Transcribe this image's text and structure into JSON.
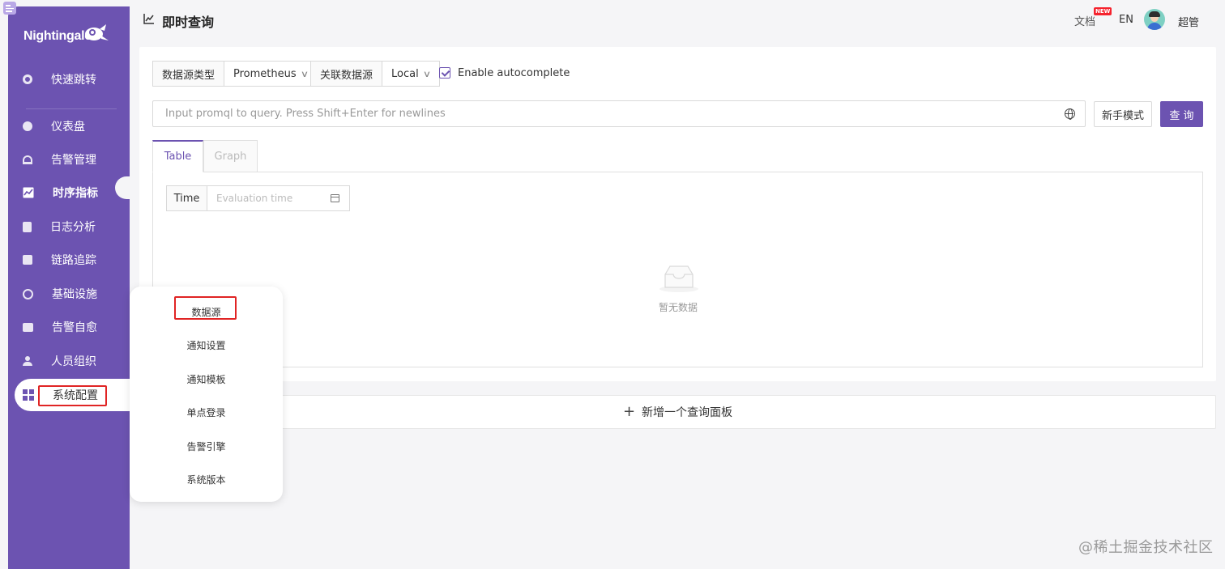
{
  "app": {
    "logo_text": "Nightingale",
    "accent_color": "#6c53b1"
  },
  "sidebar": {
    "items": [
      {
        "label": "快速跳转",
        "icon": "search-icon"
      },
      {
        "label": "仪表盘",
        "icon": "dashboard-icon"
      },
      {
        "label": "告警管理",
        "icon": "alarm-icon"
      },
      {
        "label": "时序指标",
        "icon": "line-chart-icon"
      },
      {
        "label": "日志分析",
        "icon": "document-icon"
      },
      {
        "label": "链路追踪",
        "icon": "link-icon"
      },
      {
        "label": "基础设施",
        "icon": "target-icon"
      },
      {
        "label": "告警自愈",
        "icon": "terminal-icon"
      },
      {
        "label": "人员组织",
        "icon": "user-icon"
      },
      {
        "label": "系统配置",
        "icon": "grid-icon"
      }
    ]
  },
  "submenu": {
    "items": [
      "数据源",
      "通知设置",
      "通知模板",
      "单点登录",
      "告警引擎",
      "系统版本"
    ]
  },
  "header": {
    "title": "即时查询",
    "docs_label": "文档",
    "new_badge": "NEW",
    "lang_label": "EN",
    "user_label": "超管",
    "chevron": "∨"
  },
  "query": {
    "datasource_type_label": "数据源类型",
    "datasource_type_value": "Prometheus",
    "related_datasource_label": "关联数据源",
    "related_datasource_value": "Local",
    "autocomplete_label": "Enable autocomplete",
    "autocomplete_checked": true,
    "input_placeholder": "Input promql to query. Press Shift+Enter for newlines",
    "beginner_mode_button": "新手模式",
    "query_button": "查 询"
  },
  "tabs": {
    "table_label": "Table",
    "graph_label": "Graph",
    "active": "Table"
  },
  "table_panel": {
    "time_label": "Time",
    "time_placeholder": "Evaluation time",
    "empty_text": "暂无数据"
  },
  "add_panel": {
    "label": "新增一个查询面板",
    "plus": "+"
  },
  "watermark": "@稀土掘金技术社区"
}
